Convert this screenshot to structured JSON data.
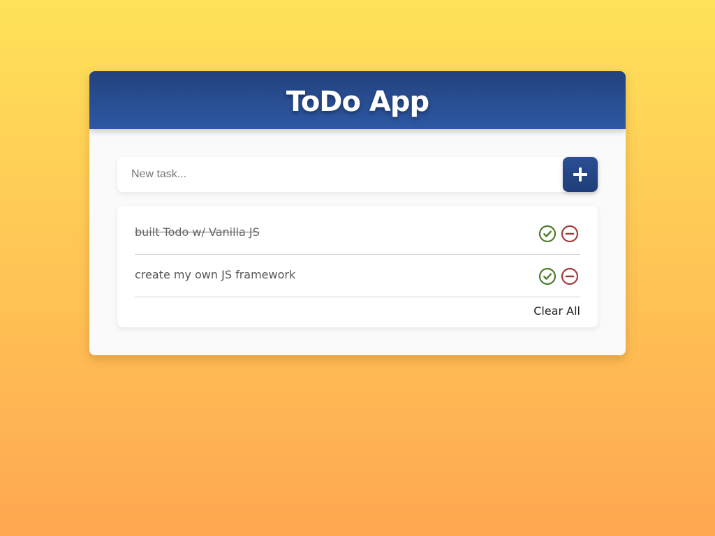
{
  "app": {
    "title": "ToDo App"
  },
  "input": {
    "placeholder": "New task...",
    "value": ""
  },
  "add_button": {
    "icon": "plus-icon"
  },
  "todos": [
    {
      "text": "built Todo w/ Vanilla JS",
      "completed": true,
      "complete_icon": "check-circle-icon",
      "remove_icon": "minus-circle-icon"
    },
    {
      "text": "create my own JS framework",
      "completed": false,
      "complete_icon": "check-circle-icon",
      "remove_icon": "minus-circle-icon"
    }
  ],
  "clear_all_label": "Clear All",
  "colors": {
    "background_top": "#ffe259",
    "background_bottom": "#ffa751",
    "header": "#2a4f93",
    "complete": "#4e7a2a",
    "remove": "#a33a3a"
  }
}
